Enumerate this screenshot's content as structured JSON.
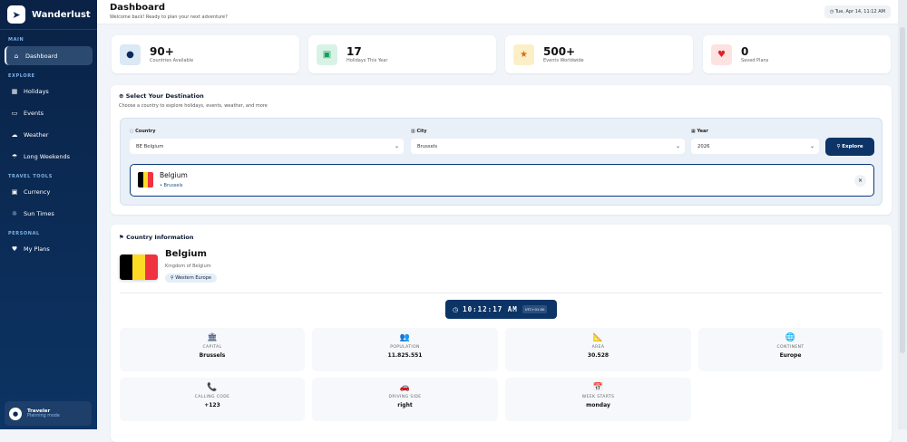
{
  "app": {
    "name": "Wanderlust"
  },
  "sidebar": {
    "sections": [
      {
        "title": "MAIN",
        "items": [
          {
            "label": "Dashboard",
            "icon": "home-icon"
          }
        ]
      },
      {
        "title": "EXPLORE",
        "items": [
          {
            "label": "Holidays",
            "icon": "calendar-icon"
          },
          {
            "label": "Events",
            "icon": "ticket-icon"
          },
          {
            "label": "Weather",
            "icon": "cloud-sun-icon"
          },
          {
            "label": "Long Weekends",
            "icon": "umbrella-beach-icon"
          }
        ]
      },
      {
        "title": "TRAVEL TOOLS",
        "items": [
          {
            "label": "Currency",
            "icon": "money-icon"
          },
          {
            "label": "Sun Times",
            "icon": "sun-icon"
          }
        ]
      },
      {
        "title": "PERSONAL",
        "items": [
          {
            "label": "My Plans",
            "icon": "heart-icon"
          }
        ]
      }
    ],
    "user": {
      "name": "Traveler",
      "status": "Planning mode"
    }
  },
  "header": {
    "title": "Dashboard",
    "subtitle": "Welcome back! Ready to plan your next adventure?",
    "datetime": "Tue, Apr 14, 11:12 AM"
  },
  "stats": [
    {
      "value": "90+",
      "label": "Countries Available",
      "icon": "globe-icon",
      "bg": "#dbe8f5",
      "color": "#0c2a5a"
    },
    {
      "value": "17",
      "label": "Holidays This Year",
      "icon": "calendar-check-icon",
      "bg": "#d8f3e6",
      "color": "#12a05a"
    },
    {
      "value": "500+",
      "label": "Events Worldwide",
      "icon": "star-icon",
      "bg": "#fcefc7",
      "color": "#d9700a"
    },
    {
      "value": "0",
      "label": "Saved Plans",
      "icon": "heart-icon",
      "bg": "#fde2e2",
      "color": "#e0202a"
    }
  ],
  "destination": {
    "title": "Select Your Destination",
    "subtitle": "Choose a country to explore holidays, events, weather, and more",
    "country_label": "Country",
    "country_value": "BE Belgium",
    "city_label": "City",
    "city_value": "Brussels",
    "year_label": "Year",
    "year_value": "2026",
    "explore_label": "Explore",
    "selected": {
      "country": "Belgium",
      "city": "• Brussels",
      "close": "×"
    }
  },
  "country_info": {
    "title": "Country Information",
    "name": "Belgium",
    "official": "Kingdom of Belgium",
    "region": "Western Europe",
    "time": "10:12:17 AM",
    "utc": "UTC+01:00",
    "flag_colors": [
      "#000000",
      "#fdda24",
      "#ef3340"
    ],
    "facts": [
      {
        "label": "CAPITAL",
        "value": "Brussels",
        "icon": "landmark-icon",
        "glyph": "🏛"
      },
      {
        "label": "POPULATION",
        "value": "11.825.551",
        "icon": "people-icon",
        "glyph": "👥"
      },
      {
        "label": "AREA",
        "value": "30.528",
        "icon": "ruler-icon",
        "glyph": "📐"
      },
      {
        "label": "CONTINENT",
        "value": "Europe",
        "icon": "globe-icon",
        "glyph": "🌐"
      },
      {
        "label": "CALLING CODE",
        "value": "+123",
        "icon": "phone-icon",
        "glyph": "📞"
      },
      {
        "label": "DRIVING SIDE",
        "value": "right",
        "icon": "car-icon",
        "glyph": "🚗"
      },
      {
        "label": "WEEK STARTS",
        "value": "monday",
        "icon": "calendar-icon",
        "glyph": "📅"
      }
    ]
  }
}
